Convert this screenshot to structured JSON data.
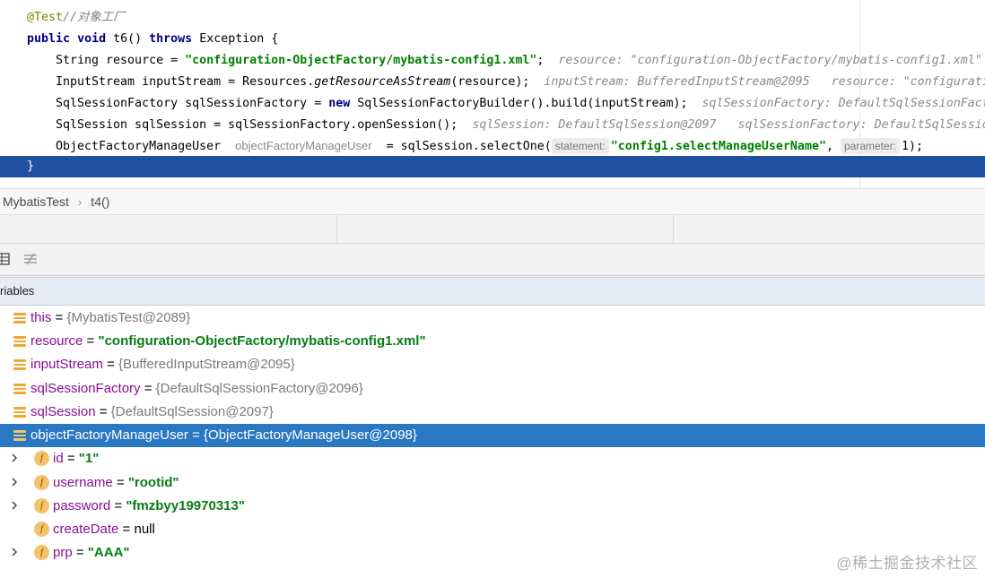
{
  "editor": {
    "lines": [
      {
        "annotation": "@Test",
        "comment": "//对象工厂"
      },
      {
        "kw1": "public",
        "kw2": "void",
        "sig": "t6()",
        "kw3": "throws",
        "rest": "Exception {"
      },
      {
        "decl": "String resource = ",
        "str": "\"configuration-ObjectFactory/mybatis-config1.xml\"",
        "end": ";",
        "hint": "resource: \"configuration-ObjectFactory/mybatis-config1.xml\""
      },
      {
        "decl": "InputStream inputStream = Resources.",
        "method": "getResourceAsStream",
        "end": "(resource);",
        "hint": "inputStream: BufferedInputStream@2095   resource: \"configuratio"
      },
      {
        "decl": "SqlSessionFactory sqlSessionFactory = ",
        "kw": "new",
        "rest": " SqlSessionFactoryBuilder().build(inputStream);",
        "hint": "sqlSessionFactory: DefaultSqlSessionFact"
      },
      {
        "decl": "SqlSession sqlSession = sqlSessionFactory.openSession();",
        "hint": "sqlSession: DefaultSqlSession@2097   sqlSessionFactory: DefaultSqlSession"
      },
      {
        "decl": "ObjectFactoryManageUser",
        "inlay": "objectFactoryManageUser",
        "mid": " = sqlSession.selectOne(",
        "chip1": "statement:",
        "str": "\"config1.selectManageUserName\"",
        "comma": ", ",
        "chip2": "parameter:",
        "end": "1);"
      },
      {
        "text": "}"
      }
    ]
  },
  "breadcrumb": {
    "class": "MybatisTest",
    "method": "t4()"
  },
  "variables": {
    "header": "riables",
    "items": [
      {
        "name": "this",
        "eq": " = ",
        "value": "{MybatisTest@2089}",
        "kind": "obj"
      },
      {
        "name": "resource",
        "eq": " = ",
        "value": "\"configuration-ObjectFactory/mybatis-config1.xml\"",
        "kind": "str"
      },
      {
        "name": "inputStream",
        "eq": " = ",
        "value": "{BufferedInputStream@2095}",
        "kind": "obj"
      },
      {
        "name": "sqlSessionFactory",
        "eq": " = ",
        "value": "{DefaultSqlSessionFactory@2096}",
        "kind": "obj"
      },
      {
        "name": "sqlSession",
        "eq": " = ",
        "value": "{DefaultSqlSession@2097}",
        "kind": "obj"
      },
      {
        "name": "objectFactoryManageUser",
        "eq": " = ",
        "value": "{ObjectFactoryManageUser@2098}",
        "kind": "obj",
        "selected": true
      }
    ],
    "fields": [
      {
        "name": "id",
        "eq": " = ",
        "value": "\"1\"",
        "expandable": true
      },
      {
        "name": "username",
        "eq": " = ",
        "value": "\"rootid\"",
        "expandable": true
      },
      {
        "name": "password",
        "eq": " = ",
        "value": "\"fmzbyy19970313\"",
        "expandable": true
      },
      {
        "name": "createDate",
        "eq": " = ",
        "value": "null",
        "expandable": false
      },
      {
        "name": "prp",
        "eq": " = ",
        "value": "\"AAA\"",
        "expandable": true
      }
    ]
  },
  "icons": {
    "field": "f",
    "expand": "›"
  },
  "watermark": "@稀土掘金技术社区",
  "colors": {
    "selection": "#2b78c2",
    "exec_line": "#2250a0",
    "string": "#067d17",
    "variable_icon": "#f0a732"
  }
}
